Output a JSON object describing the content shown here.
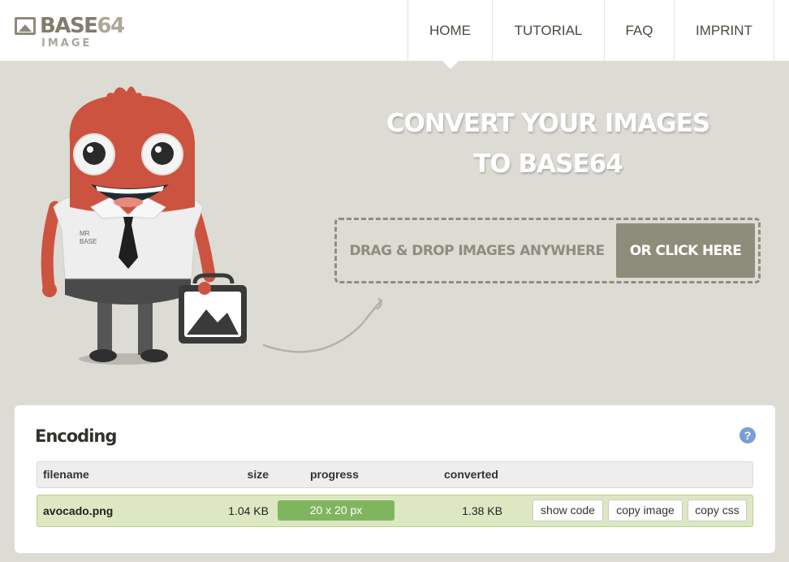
{
  "logo": {
    "title_main": "BASE",
    "title_accent": "64",
    "subtitle": "IMAGE"
  },
  "nav": [
    {
      "label": "HOME",
      "active": true
    },
    {
      "label": "TUTORIAL"
    },
    {
      "label": "FAQ"
    },
    {
      "label": "IMPRINT"
    }
  ],
  "hero": {
    "title_line1": "CONVERT YOUR IMAGES",
    "title_line2": "TO BASE64",
    "drop_text": "DRAG & DROP IMAGES ANYWHERE",
    "click_button": "OR CLICK HERE",
    "mascot_shirt_text_line1": "MR",
    "mascot_shirt_text_line2": "BASE"
  },
  "encoding": {
    "title": "Encoding",
    "help_icon": "?",
    "columns": {
      "filename": "filename",
      "size": "size",
      "progress": "progress",
      "converted": "converted"
    },
    "rows": [
      {
        "filename": "avocado.png",
        "size": "1.04 KB",
        "progress": "20 x 20 px",
        "converted": "1.38 KB",
        "actions": {
          "show_code": "show code",
          "copy_image": "copy image",
          "copy_css": "copy css"
        }
      }
    ]
  },
  "colors": {
    "background": "#dcdbd4",
    "accent": "#8e8d7b",
    "mascot_red": "#cc5340",
    "row_success": "#dde8c2",
    "progress_green": "#80b560",
    "help_blue": "#7a9fd2"
  }
}
